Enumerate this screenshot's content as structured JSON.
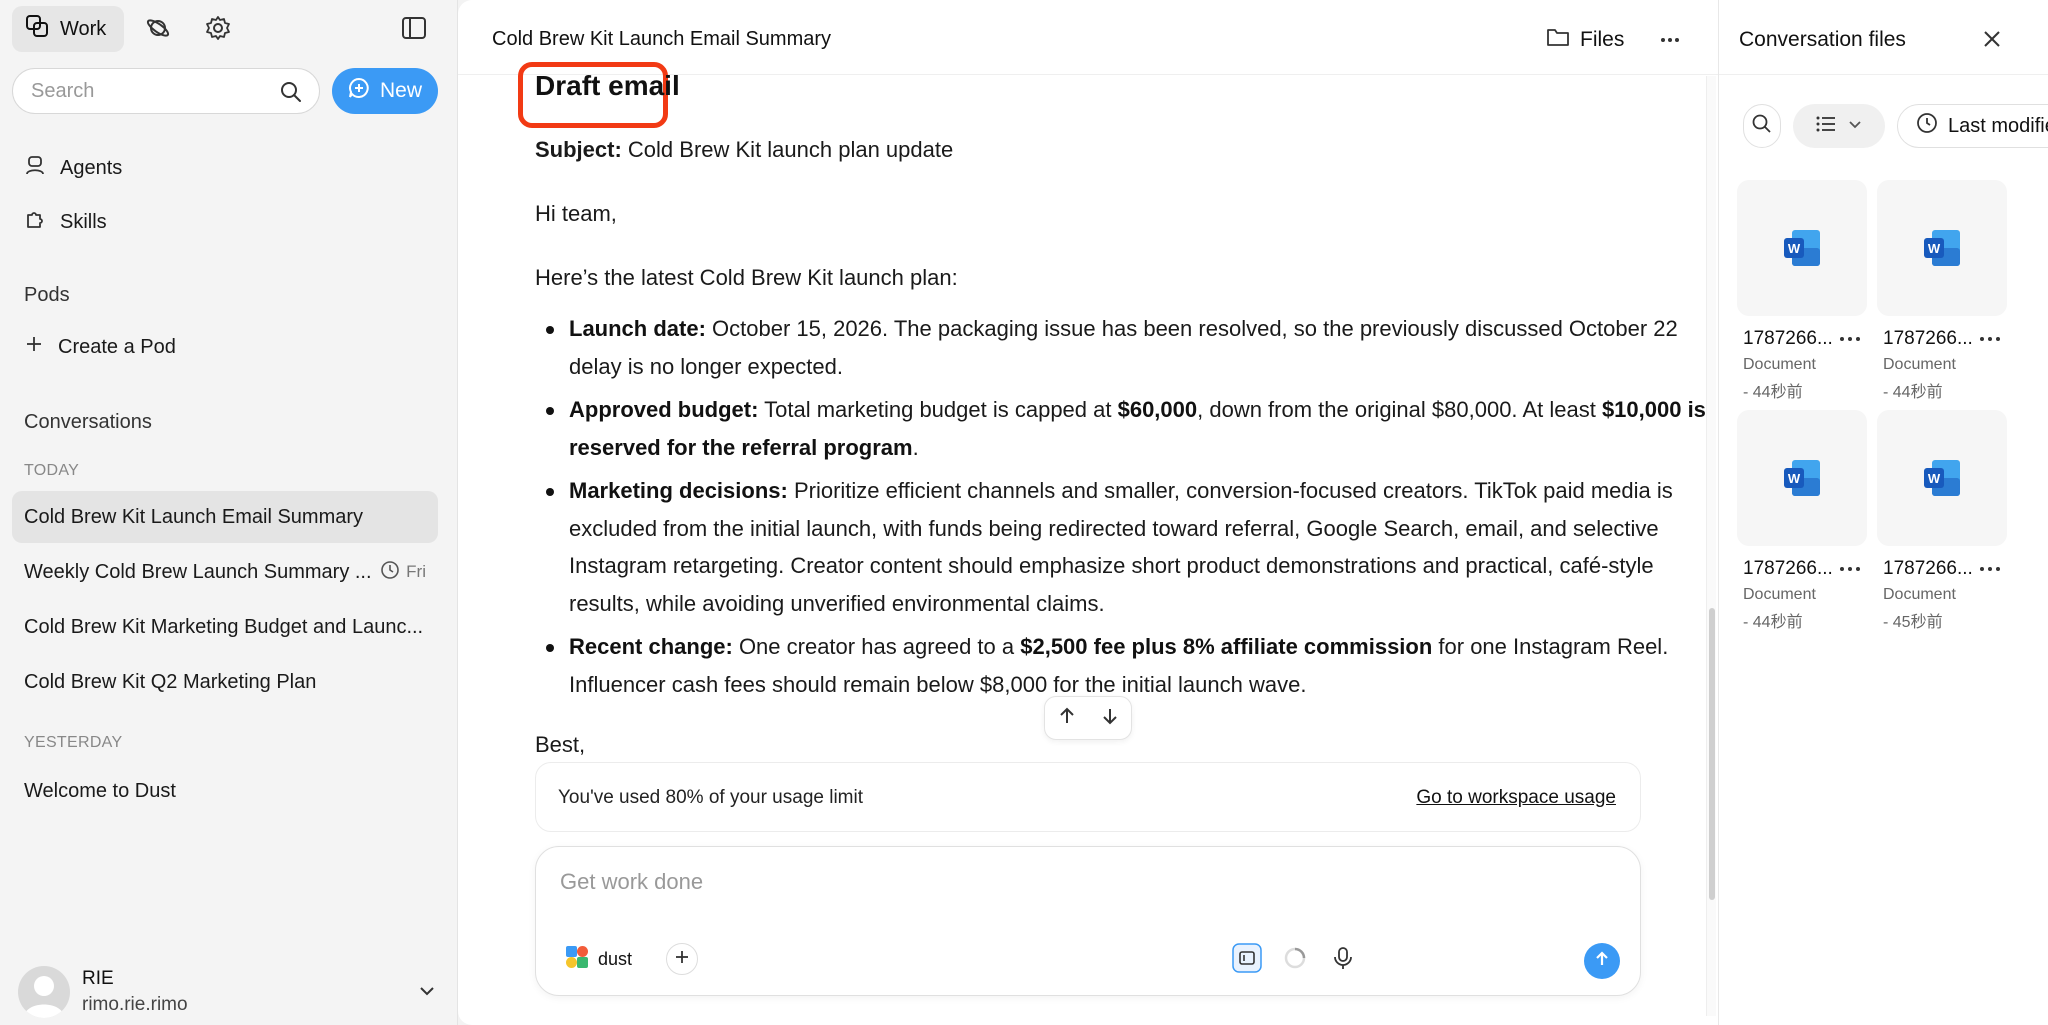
{
  "sidebar": {
    "work_label": "Work",
    "search_placeholder": "Search",
    "new_label": "New",
    "nav": {
      "agents": "Agents",
      "skills": "Skills"
    },
    "pods_title": "Pods",
    "create_pod": "Create a Pod",
    "conversations_title": "Conversations",
    "today_label": "TODAY",
    "yesterday_label": "YESTERDAY",
    "today_items": [
      {
        "label": "Cold Brew Kit Launch Email Summary"
      },
      {
        "label": "Weekly Cold Brew Launch Summary ...",
        "meta": "Fri"
      },
      {
        "label": "Cold Brew Kit Marketing Budget and Launc..."
      },
      {
        "label": "Cold Brew Kit Q2 Marketing Plan"
      }
    ],
    "yesterday_items": [
      {
        "label": "Welcome to Dust"
      }
    ],
    "user": {
      "name": "RIE",
      "email": "rimo.rie.rimo"
    }
  },
  "main": {
    "title": "Cold Brew Kit Launch Email Summary",
    "files_label": "Files",
    "draft_title": "Draft email",
    "subject_label": "Subject:",
    "subject_text": " Cold Brew Kit launch plan update",
    "greeting": "Hi team,",
    "intro": "Here’s the latest Cold Brew Kit launch plan:",
    "bullets": [
      {
        "b1": "Launch date:",
        "t1": " October 15, 2026. The packaging issue has been resolved, so the previously discussed October 22 delay is no longer expected."
      },
      {
        "b1": "Approved budget:",
        "t1": " Total marketing budget is capped at ",
        "b2": "$60,000",
        "t2": ", down from the original $80,000. At least ",
        "b3": "$10,000 is reserved for the referral program",
        "t3": "."
      },
      {
        "b1": "Marketing decisions:",
        "t1": " Prioritize efficient channels and smaller, conversion-focused creators. TikTok paid media is excluded from the initial launch, with funds being redirected toward referral, Google Search, email, and selective Instagram retargeting. Creator content should emphasize short product demonstrations and practical, café-style results, while avoiding unverified environmental claims."
      },
      {
        "b1": "Recent change:",
        "t1": " One creator has agreed to a ",
        "b2": "$2,500 fee plus 8% affiliate commission",
        "t2": " for one Instagram Reel. Influencer cash fees should remain below $8,000 for the initial launch wave."
      }
    ],
    "signoff": "Best,",
    "usage_text": "You've used 80% of your usage limit",
    "usage_link": "Go to workspace usage",
    "composer_placeholder": "Get work done",
    "agent_chip": "dust"
  },
  "files_panel": {
    "title": "Conversation files",
    "sort_label": "Last modified",
    "files": [
      {
        "name": "1787266...",
        "type": "Document",
        "time": "- 44秒前"
      },
      {
        "name": "1787266...",
        "type": "Document",
        "time": "- 44秒前"
      },
      {
        "name": "1787266...",
        "type": "Document",
        "time": "- 44秒前"
      },
      {
        "name": "1787266...",
        "type": "Document",
        "time": "- 45秒前"
      }
    ]
  },
  "colors": {
    "accent": "#3b9af5",
    "highlight": "#f23a14",
    "word_blue": "#185abd"
  }
}
